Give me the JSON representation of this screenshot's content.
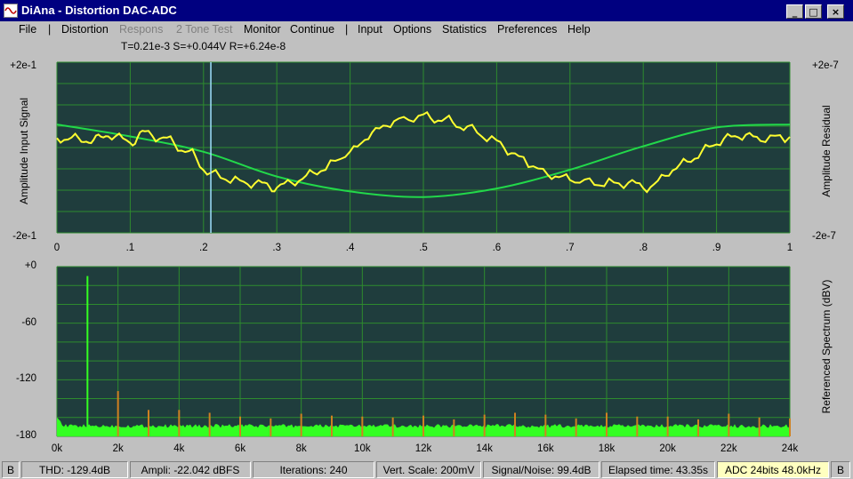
{
  "window": {
    "title": "DiAna - Distortion DAC-ADC",
    "buttons": {
      "minimize": "_",
      "maximize": "□",
      "close": "×"
    }
  },
  "menu": {
    "file": "File",
    "sep1": "|",
    "distortion": "Distortion",
    "respons": "Respons",
    "two_tone": "2 Tone Test",
    "monitor": "Monitor",
    "continue": "Continue",
    "sep2": "|",
    "input": "Input",
    "options": "Options",
    "statistics": "Statistics",
    "preferences": "Preferences",
    "help": "Help"
  },
  "readout": {
    "text": "T=0.21e-3  S=+0.044V  R=+6.24e-8"
  },
  "signal_plot": {
    "left_label": "Amplitude Input Signal",
    "right_label": "Amplitude Residual",
    "left_top": "+2e-1",
    "left_bottom": "-2e-1",
    "right_top": "+2e-7",
    "right_bottom": "-2e-7",
    "x_ticks": [
      "0",
      ".1",
      ".2",
      ".3",
      ".4",
      ".5",
      ".6",
      ".7",
      ".8",
      ".9",
      "1"
    ]
  },
  "spectrum_plot": {
    "right_label": "Referenced Spectrum (dBV)",
    "y_ticks": [
      "+0",
      "-60",
      "-120",
      "-180"
    ],
    "x_ticks": [
      "0k",
      "2k",
      "4k",
      "6k",
      "8k",
      "10k",
      "12k",
      "14k",
      "16k",
      "18k",
      "20k",
      "22k",
      "24k"
    ]
  },
  "colors": {
    "plot_bg": "#1f3d3d",
    "grid": "#2e8b2e",
    "signal": "#22d84a",
    "residual": "#ffff30",
    "spectrum": "#33ff22",
    "harmonic": "#d08020",
    "cursor": "#a0e0ff"
  },
  "chart_data": [
    {
      "type": "line",
      "title": "",
      "xlabel": "",
      "ylabel": "Amplitude Input Signal",
      "xlim": [
        0,
        1
      ],
      "ylim": [
        -0.2,
        0.2
      ],
      "y2label": "Amplitude Residual",
      "y2lim": [
        -2e-07,
        2e-07
      ],
      "cursor_x": 0.21,
      "grid": true,
      "series": [
        {
          "x": [
            0.0,
            0.1,
            0.2,
            0.3,
            0.4,
            0.5,
            0.6,
            0.7,
            0.8,
            0.9,
            1.0
          ],
          "y": [
            0.054,
            0.026,
            -0.01,
            -0.068,
            -0.103,
            -0.116,
            -0.096,
            -0.052,
            0.003,
            0.047,
            0.054
          ]
        },
        {
          "x": [
            0.0,
            0.03,
            0.05,
            0.07,
            0.1,
            0.12,
            0.15,
            0.18,
            0.21,
            0.25,
            0.28,
            0.3,
            0.33,
            0.36,
            0.4,
            0.43,
            0.46,
            0.5,
            0.53,
            0.56,
            0.6,
            0.63,
            0.67,
            0.7,
            0.74,
            0.78,
            0.81,
            0.84,
            0.87,
            0.9,
            0.93,
            0.96,
            1.0
          ],
          "y": [
            2.2e-08,
            2e-08,
            1.6e-08,
            3e-08,
            1.4e-08,
            3.4e-08,
            1.9e-08,
            -1.2e-08,
            -6.2e-08,
            -8e-08,
            -8.6e-08,
            -9.3e-08,
            -7.6e-08,
            -5.2e-08,
            -1.2e-08,
            3.4e-08,
            6.2e-08,
            7.3e-08,
            6.4e-08,
            4.6e-08,
            1.4e-08,
            -2.4e-08,
            -6.2e-08,
            -7.5e-08,
            -8.4e-08,
            -8.4e-08,
            -9.3e-08,
            -5.2e-08,
            -2.3e-08,
            1.2e-08,
            2.9e-08,
            2.1e-08,
            2.5e-08
          ]
        }
      ]
    },
    {
      "type": "bar",
      "title": "",
      "xlabel": "",
      "ylabel": "Referenced Spectrum (dBV)",
      "xlim": [
        0,
        24000
      ],
      "ylim": [
        -180,
        0
      ],
      "grid": true,
      "noise_floor_db": -170,
      "series": [
        {
          "x": [
            1000
          ],
          "y": [
            -10
          ]
        },
        {
          "x": [
            2000,
            3000,
            4000,
            5000,
            6000,
            7000,
            8000,
            9000,
            10000,
            11000,
            12000,
            13000,
            14000,
            15000,
            16000,
            17000,
            18000,
            19000,
            20000,
            21000,
            22000,
            23000,
            24000
          ],
          "y": [
            -132,
            -152,
            -152,
            -155,
            -159,
            -161,
            -156,
            -158,
            -159,
            -160,
            -158,
            -162,
            -157,
            -155,
            -157,
            -161,
            -155,
            -159,
            -159,
            -162,
            -156,
            -160,
            -161
          ]
        }
      ]
    }
  ],
  "status": {
    "left_b": "B",
    "thd": "THD: -129.4dB",
    "ampli": "Ampli: -22.042 dBFS",
    "iterations": "Iterations: 240",
    "vert_scale": "Vert. Scale: 200mV",
    "snr": "Signal/Noise:   99.4dB",
    "elapsed": "Elapsed time: 43.35s",
    "adc": "ADC 24bits 48.0kHz",
    "right_b": "B"
  }
}
